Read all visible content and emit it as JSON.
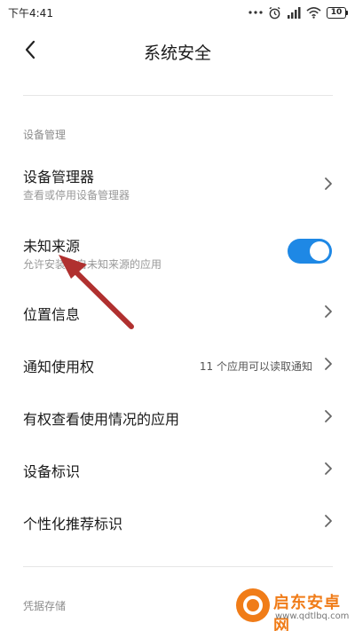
{
  "status_bar": {
    "time": "下午4:41",
    "battery": "10"
  },
  "header": {
    "title": "系统安全",
    "back_icon": "chevron-left-icon"
  },
  "sections": [
    {
      "header": "设备管理",
      "rows": [
        {
          "title": "设备管理器",
          "subtitle": "查看或停用设备管理器",
          "control": "chevron"
        },
        {
          "title": "未知来源",
          "subtitle": "允许安装来自未知来源的应用",
          "control": "toggle",
          "toggle_on": true
        },
        {
          "title": "位置信息",
          "control": "chevron"
        },
        {
          "title": "通知使用权",
          "value": "11 个应用可以读取通知",
          "control": "chevron"
        },
        {
          "title": "有权查看使用情况的应用",
          "control": "chevron"
        },
        {
          "title": "设备标识",
          "control": "chevron"
        },
        {
          "title": "个性化推荐标识",
          "control": "chevron"
        }
      ]
    },
    {
      "header": "凭据存储"
    }
  ],
  "annotation": {
    "color": "#b0302f"
  },
  "watermark": {
    "name": "启东安卓网",
    "url": "www.qdtlbq.com"
  },
  "colors": {
    "toggle_on": "#1e88e5",
    "watermark": "#f07c18"
  }
}
